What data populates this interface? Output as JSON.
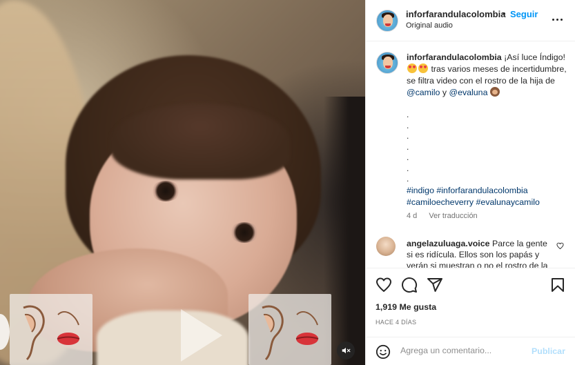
{
  "post": {
    "username": "inforfarandulacolombia",
    "separator": "•",
    "follow_label": "Seguir",
    "audio_label": "Original audio",
    "caption": {
      "username": "inforfarandulacolombia",
      "line1": "¡Así luce Índigo!",
      "line2": " tras varios meses de incertidumbre, se filtra video con el rostro de la hija de ",
      "mention1": "@camilo",
      "line3": " y ",
      "mention2": "@evaluna",
      "dots": ". . . . . . . .",
      "hashtags_line1": "#indigo #inforfarandulacolombia",
      "hashtags_line2": "#camiloecheverry #evalunaycamilo",
      "age": "4 d",
      "translate_label": "Ver traducción"
    },
    "comment": {
      "username": "angelazuluaga.voice",
      "text": " Parce la gente si es ridícula. Ellos son los papás y verán si muestran o no el rostro de la niña"
    },
    "likes": "1,919 Me gusta",
    "time_ago": "HACE 4 DÍAS",
    "composer": {
      "placeholder": "Agrega un comentario...",
      "publish_label": "Publicar"
    }
  },
  "icons": {
    "more": "more-options-icon",
    "like": "heart-icon",
    "comment": "comment-icon",
    "share": "share-icon",
    "save": "bookmark-icon",
    "emoji": "emoji-icon",
    "mute": "muted-speaker-icon"
  },
  "colors": {
    "link": "#0095f6",
    "mention": "#00376b",
    "publish_disabled": "#b2dffc"
  }
}
